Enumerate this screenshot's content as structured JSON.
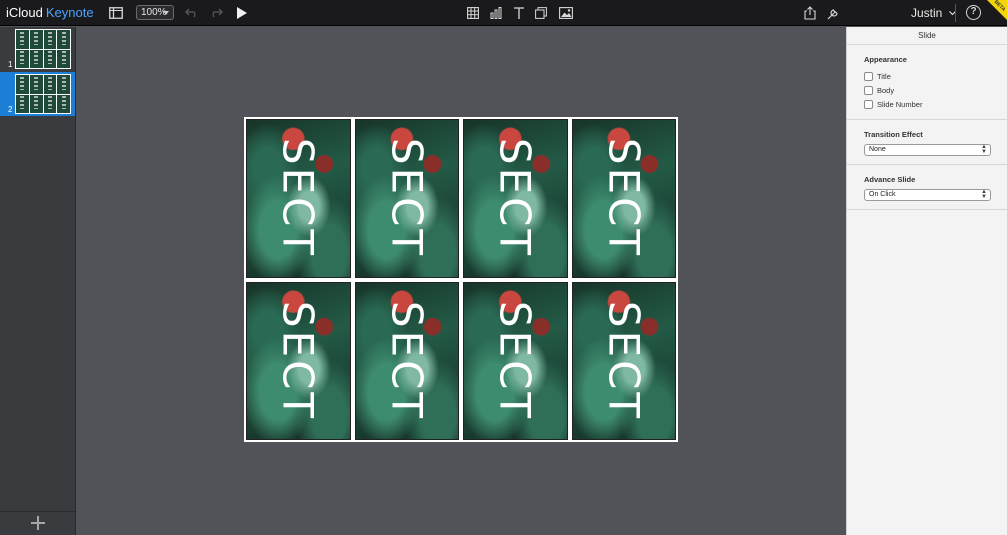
{
  "toolbar": {
    "brand_prefix": "iCloud",
    "brand_app": "Keynote",
    "zoom_value": "100%",
    "user_name": "Justin",
    "help_glyph": "?",
    "beta_label": "BETA",
    "icons": [
      "view-toggle-icon",
      "undo-icon",
      "redo-icon",
      "play-icon",
      "table-icon",
      "chart-icon",
      "text-icon",
      "shape-icon",
      "media-icon",
      "share-icon",
      "tools-icon",
      "help-icon"
    ]
  },
  "navigator": {
    "slides": [
      {
        "number": "1",
        "selected": false
      },
      {
        "number": "2",
        "selected": true
      }
    ]
  },
  "canvas": {
    "card_word": "SECT",
    "card_count": 8
  },
  "inspector": {
    "header": "Slide",
    "appearance": {
      "title": "Appearance",
      "options": [
        {
          "label": "Title",
          "checked": false
        },
        {
          "label": "Body",
          "checked": false
        },
        {
          "label": "Slide Number",
          "checked": false
        }
      ]
    },
    "transition": {
      "title": "Transition Effect",
      "value": "None"
    },
    "advance": {
      "title": "Advance Slide",
      "value": "On Click"
    }
  },
  "colors": {
    "accent": "#1c7fd6",
    "brand_blue": "#4aa3ff",
    "toolbar": "#1a1a1c",
    "canvas_bg": "#515358",
    "beta": "#f4d40c"
  }
}
